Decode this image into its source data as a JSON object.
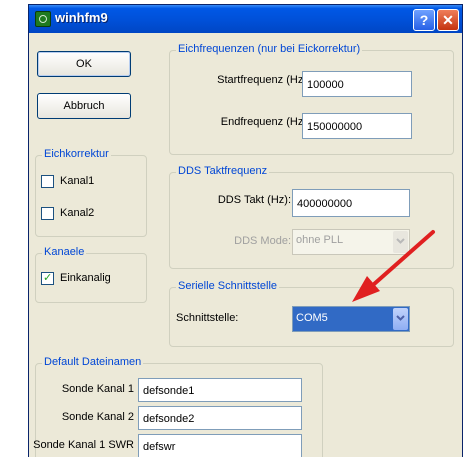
{
  "window": {
    "title": "winhfm9"
  },
  "buttons": {
    "ok": "OK",
    "cancel": "Abbruch"
  },
  "eichfrequenzen": {
    "legend": "Eichfrequenzen (nur bei Eickorrektur)",
    "start_label": "Startfrequenz (Hz)",
    "start_value": "100000",
    "end_label": "Endfrequenz (Hz)",
    "end_value": "150000000"
  },
  "eichkorrektur": {
    "legend": "Eichkorrektur",
    "kanal1": {
      "label": "Kanal1",
      "checked": false
    },
    "kanal2": {
      "label": "Kanal2",
      "checked": false
    }
  },
  "kanaele": {
    "legend": "Kanaele",
    "einkanalig": {
      "label": "Einkanalig",
      "checked": true
    }
  },
  "dds": {
    "legend": "DDS Taktfrequenz",
    "takt_label": "DDS Takt (Hz):",
    "takt_value": "400000000",
    "mode_label": "DDS Mode:",
    "mode_value": "ohne PLL"
  },
  "seriell": {
    "legend": "Serielle Schnittstelle",
    "label": "Schnittstelle:",
    "value": "COM5"
  },
  "dateinamen": {
    "legend": "Default Dateinamen",
    "rows": [
      {
        "label": "Sonde Kanal 1",
        "value": "defsonde1"
      },
      {
        "label": "Sonde Kanal 2",
        "value": "defsonde2"
      },
      {
        "label": "Sonde Kanal 1 SWR",
        "value": "defswr"
      }
    ]
  },
  "icons": {
    "app": "app-icon",
    "help": "help-icon",
    "close": "close-icon",
    "arrow": "red-arrow-annotation"
  },
  "colors": {
    "titlebar": "#0050d8",
    "accent": "#0046d5",
    "selection": "#316ac5",
    "arrow": "#e02020"
  }
}
